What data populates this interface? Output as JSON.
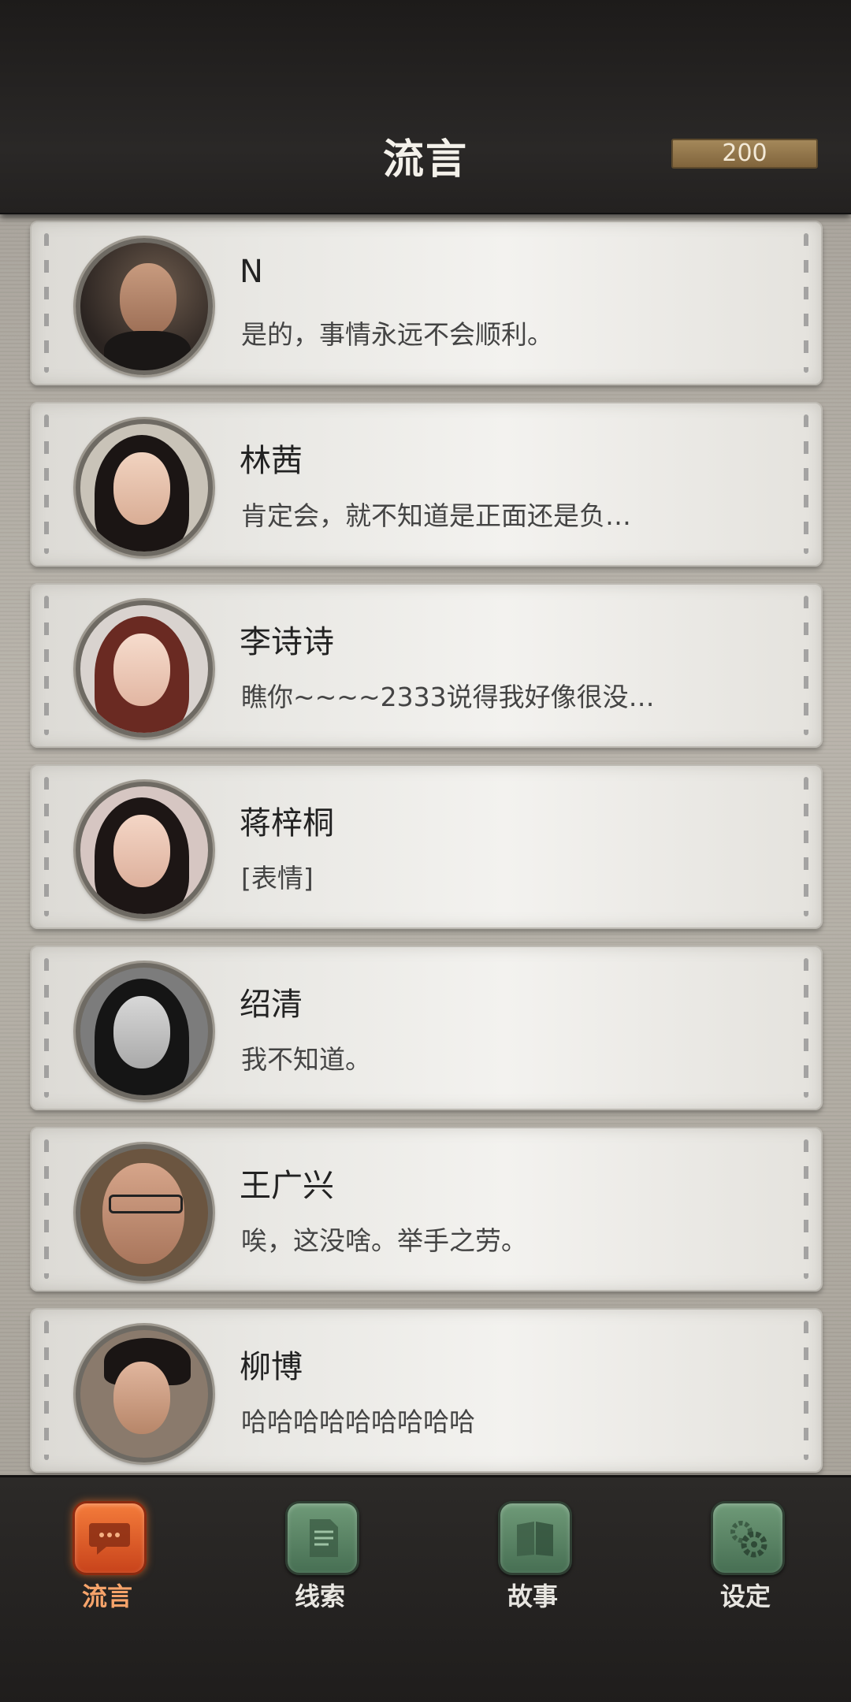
{
  "header": {
    "title": "流言",
    "coins": "200"
  },
  "contacts": [
    {
      "name": "N",
      "message": "是的，事情永远不会顺利。"
    },
    {
      "name": "林茜",
      "message": "肯定会，就不知道是正面还是负…"
    },
    {
      "name": "李诗诗",
      "message": "瞧你~~~~2333说得我好像很没…"
    },
    {
      "name": "蒋梓桐",
      "message": "[表情]"
    },
    {
      "name": "绍清",
      "message": "我不知道。"
    },
    {
      "name": "王广兴",
      "message": "唉，这没啥。举手之劳。"
    },
    {
      "name": "柳博",
      "message": "哈哈哈哈哈哈哈哈哈"
    }
  ],
  "nav": [
    {
      "label": "流言",
      "icon": "chat-bubble-icon",
      "active": true
    },
    {
      "label": "线索",
      "icon": "document-icon",
      "active": false
    },
    {
      "label": "故事",
      "icon": "book-icon",
      "active": false
    },
    {
      "label": "设定",
      "icon": "gear-icon",
      "active": false
    }
  ],
  "colors": {
    "accent_active": "#e5642a",
    "nav_icon_green": "#5f8a68",
    "coin_bar": "#9c7f52"
  }
}
